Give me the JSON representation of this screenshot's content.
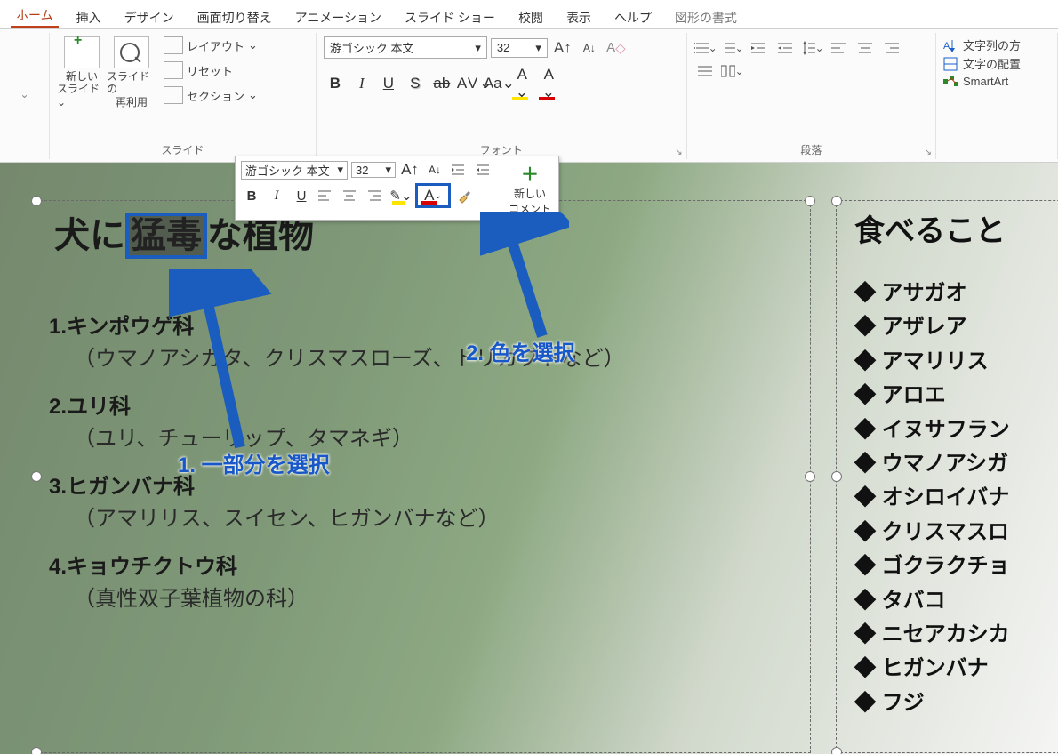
{
  "menu": {
    "home": "ホーム",
    "insert": "挿入",
    "design": "デザイン",
    "transition": "画面切り替え",
    "animation": "アニメーション",
    "slideshow": "スライド ショー",
    "review": "校閲",
    "view": "表示",
    "help": "ヘルプ",
    "shapeformat": "図形の書式"
  },
  "ribbon": {
    "clip": {
      "arrow": "⌄"
    },
    "slides": {
      "new1": "新しい",
      "new2": "スライド",
      "reuse1": "スライドの",
      "reuse2": "再利用",
      "layout": "レイアウト",
      "reset": "リセット",
      "section": "セクション",
      "group": "スライド"
    },
    "font": {
      "name": "游ゴシック 本文",
      "size": "32",
      "grow": "A",
      "shrink": "A",
      "clear": "A",
      "bold": "B",
      "italic": "I",
      "underline": "U",
      "shadow": "S",
      "strike": "ab",
      "kerning": "AV",
      "case": "Aa",
      "highlight": "A",
      "color": "A",
      "group": "フォント"
    },
    "para": {
      "group": "段落"
    },
    "draw": {
      "textdir": "文字列の方",
      "align": "文字の配置",
      "smartart": "SmartArt"
    }
  },
  "mini": {
    "fontname": "游ゴシック 本文",
    "fontsize": "32",
    "grow": "A",
    "shrink": "A",
    "bold": "B",
    "italic": "I",
    "underline": "U",
    "colorA": "A",
    "newcomment1": "新しい",
    "newcomment2": "コメント"
  },
  "slide": {
    "title_pre": "犬に",
    "title_sel": "猛毒",
    "title_post": "な植物",
    "items": [
      {
        "head": "1.キンポウゲ科",
        "sub": "（ウマノアシガタ、クリスマスローズ、トリカブトなど）"
      },
      {
        "head": "2.ユリ科",
        "sub": "（ユリ、チューリップ、タマネギ）"
      },
      {
        "head": "3.ヒガンバナ科",
        "sub": "（アマリリス、スイセン、ヒガンバナなど）"
      },
      {
        "head": "4.キョウチクトウ科",
        "sub": "（真性双子葉植物の科）"
      }
    ],
    "side_title": "食べること",
    "side_items": [
      "アサガオ",
      "アザレア",
      "アマリリス",
      "アロエ",
      "イヌサフラン",
      "ウマノアシガ",
      "オシロイバナ",
      "クリスマスロ",
      "ゴクラクチョ",
      "タバコ",
      "ニセアカシカ",
      "ヒガンバナ",
      "フジ"
    ]
  },
  "annotations": {
    "step1": "1. 一部分を選択",
    "step2": "2. 色を選択"
  },
  "glyph": {
    "dd": "⌄",
    "ddw": "▾",
    "eraser": "◇"
  }
}
